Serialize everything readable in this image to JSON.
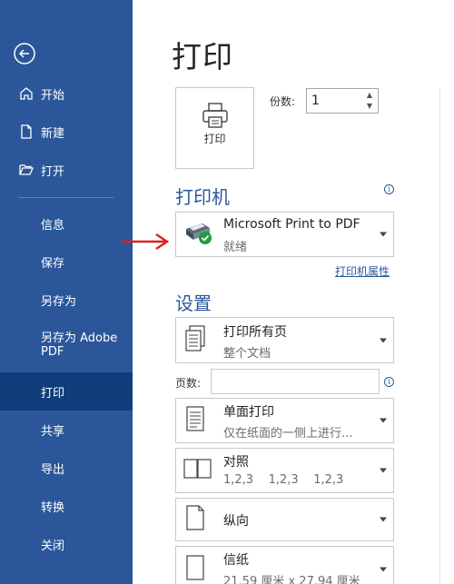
{
  "sidebar": {
    "items": [
      {
        "label": "开始"
      },
      {
        "label": "新建"
      },
      {
        "label": "打开"
      },
      {
        "label": "信息"
      },
      {
        "label": "保存"
      },
      {
        "label": "另存为"
      },
      {
        "label": "另存为 Adobe\nPDF"
      },
      {
        "label": "打印"
      },
      {
        "label": "共享"
      },
      {
        "label": "导出"
      },
      {
        "label": "转换"
      },
      {
        "label": "关闭"
      }
    ],
    "active_item": "打印"
  },
  "main": {
    "title": "打印",
    "print_button_label": "打印",
    "copies_label": "份数:",
    "copies_value": "1",
    "printer_section_title": "打印机",
    "printer": {
      "name": "Microsoft Print to PDF",
      "status": "就绪"
    },
    "printer_properties_link": "打印机属性",
    "settings_section_title": "设置",
    "settings": [
      {
        "line1": "打印所有页",
        "line2": "整个文档",
        "icon": "pages-icon"
      },
      {
        "line1": "单面打印",
        "line2": "仅在纸面的一侧上进行...",
        "icon": "one-sided-icon"
      },
      {
        "line1": "对照",
        "line2": "1,2,3    1,2,3    1,2,3",
        "icon": "collated-icon"
      },
      {
        "line1": "纵向",
        "line2": "",
        "icon": "portrait-icon"
      },
      {
        "line1": "信纸",
        "line2": "21.59 厘米 x 27.94 厘米",
        "icon": "paper-size-icon"
      }
    ],
    "pages_label": "页数:",
    "pages_value": ""
  },
  "colors": {
    "sidebar_bg": "#2b579a",
    "sidebar_active": "#103e7b",
    "accent": "#2b579a",
    "arrow": "#e02020"
  }
}
